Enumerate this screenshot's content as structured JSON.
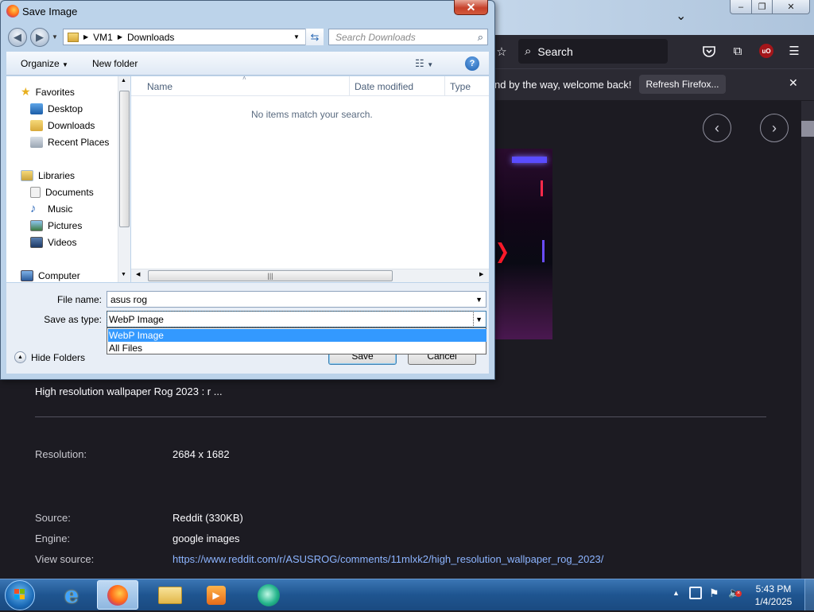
{
  "firefox": {
    "search_placeholder": "Search",
    "notification_text": "nd by the way, welcome back!",
    "refresh_button": "Refresh Firefox...",
    "close_glyph": "✕",
    "prev_glyph": "‹",
    "next_glyph": "›",
    "chevron": "⌄",
    "window_buttons": [
      "–",
      "❐",
      "✕"
    ]
  },
  "image_info": {
    "title": "High resolution wallpaper Rog 2023 : r ...",
    "resolution_label": "Resolution:",
    "resolution_value": "2684 x 1682",
    "source_label": "Source:",
    "source_value": "Reddit (330KB)",
    "engine_label": "Engine:",
    "engine_value": "google images",
    "view_source_label": "View source:",
    "view_source_url": "https://www.reddit.com/r/ASUSROG/comments/11mlxk2/high_resolution_wallpaper_rog_2023/"
  },
  "dialog": {
    "title": "Save Image",
    "close": "✕",
    "breadcrumb": [
      "VM1",
      "Downloads"
    ],
    "search_placeholder": "Search Downloads",
    "organize": "Organize",
    "new_folder": "New folder",
    "nav": {
      "favorites": "Favorites",
      "favorites_items": [
        "Desktop",
        "Downloads",
        "Recent Places"
      ],
      "libraries": "Libraries",
      "libraries_items": [
        "Documents",
        "Music",
        "Pictures",
        "Videos"
      ],
      "computer": "Computer"
    },
    "columns": [
      "Name",
      "Date modified",
      "Type"
    ],
    "empty_message": "No items match your search.",
    "file_name_label": "File name:",
    "file_name_value": "asus rog",
    "save_as_type_label": "Save as type:",
    "save_as_type_value": "WebP Image",
    "type_options": [
      "WebP Image",
      "All Files"
    ],
    "hide_folders": "Hide Folders",
    "save": "Save",
    "cancel": "Cancel"
  },
  "taskbar": {
    "time": "5:43 PM",
    "date": "1/4/2025"
  },
  "colors": {
    "ff_background": "#1c1b22",
    "ff_toolbar": "#2b2a33",
    "link": "#8cb4ff",
    "selection": "#3399ff",
    "taskbar": "#1f5590"
  }
}
